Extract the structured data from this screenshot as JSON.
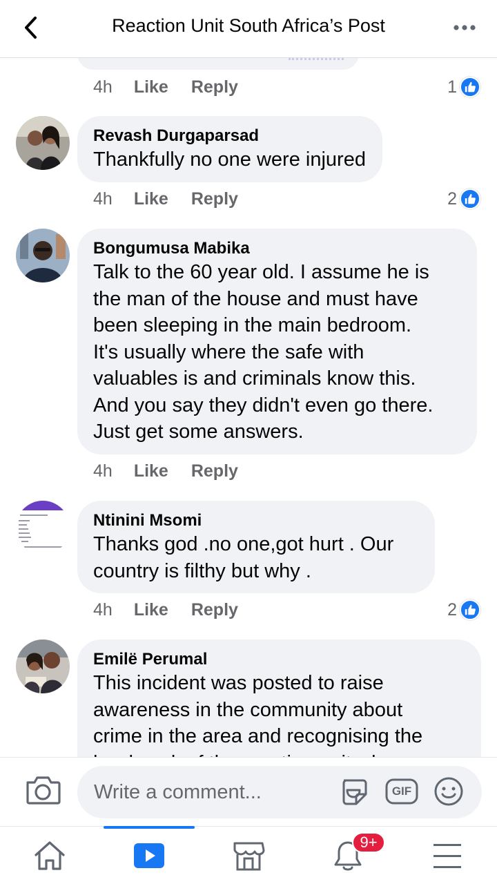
{
  "header": {
    "title": "Reaction Unit South Africa’s Post",
    "back_icon": "chevron-left-icon",
    "more_icon": "more-horizontal-icon"
  },
  "previous_comment": {
    "time": "4h",
    "like_label": "Like",
    "reply_label": "Reply",
    "reaction_count": "1"
  },
  "comments": [
    {
      "author": "Revash Durgaparsad",
      "text": "Thankfully no one were injured",
      "time": "4h",
      "like_label": "Like",
      "reply_label": "Reply",
      "reaction_count": "2"
    },
    {
      "author": "Bongumusa Mabika",
      "text": "Talk to the 60 year old. I assume he is\nthe man of the house and must have\nbeen sleeping in the main bedroom.\nIt's usually where the safe with\nvaluables is and criminals know this.\nAnd you say they didn't even go there.\nJust get some answers.",
      "time": "4h",
      "like_label": "Like",
      "reply_label": "Reply",
      "reaction_count": ""
    },
    {
      "author": "Ntinini Msomi",
      "text": "Thanks god .no one,got hurt . Our\ncountry is filthy but why .",
      "time": "4h",
      "like_label": "Like",
      "reply_label": "Reply",
      "reaction_count": "2"
    },
    {
      "author": "Emilë Perumal",
      "text": "This incident was posted to raise\nawareness in the community about\ncrime in the area and recognising the\nhard work of the reaction unit who",
      "time": "",
      "like_label": "",
      "reply_label": "",
      "reaction_count": ""
    }
  ],
  "composer": {
    "placeholder": "Write a comment...",
    "camera_icon": "camera-icon",
    "sticker_icon": "sticker-icon",
    "gif_label": "GIF",
    "emoji_icon": "emoji-icon"
  },
  "nav": {
    "items": [
      "home-icon",
      "watch-icon",
      "marketplace-icon",
      "notifications-icon",
      "menu-icon"
    ],
    "notification_badge": "9+"
  },
  "colors": {
    "accent": "#1877f2",
    "bubble": "#f0f2f5",
    "secondary_text": "#65676b",
    "badge": "#e41e3f"
  }
}
